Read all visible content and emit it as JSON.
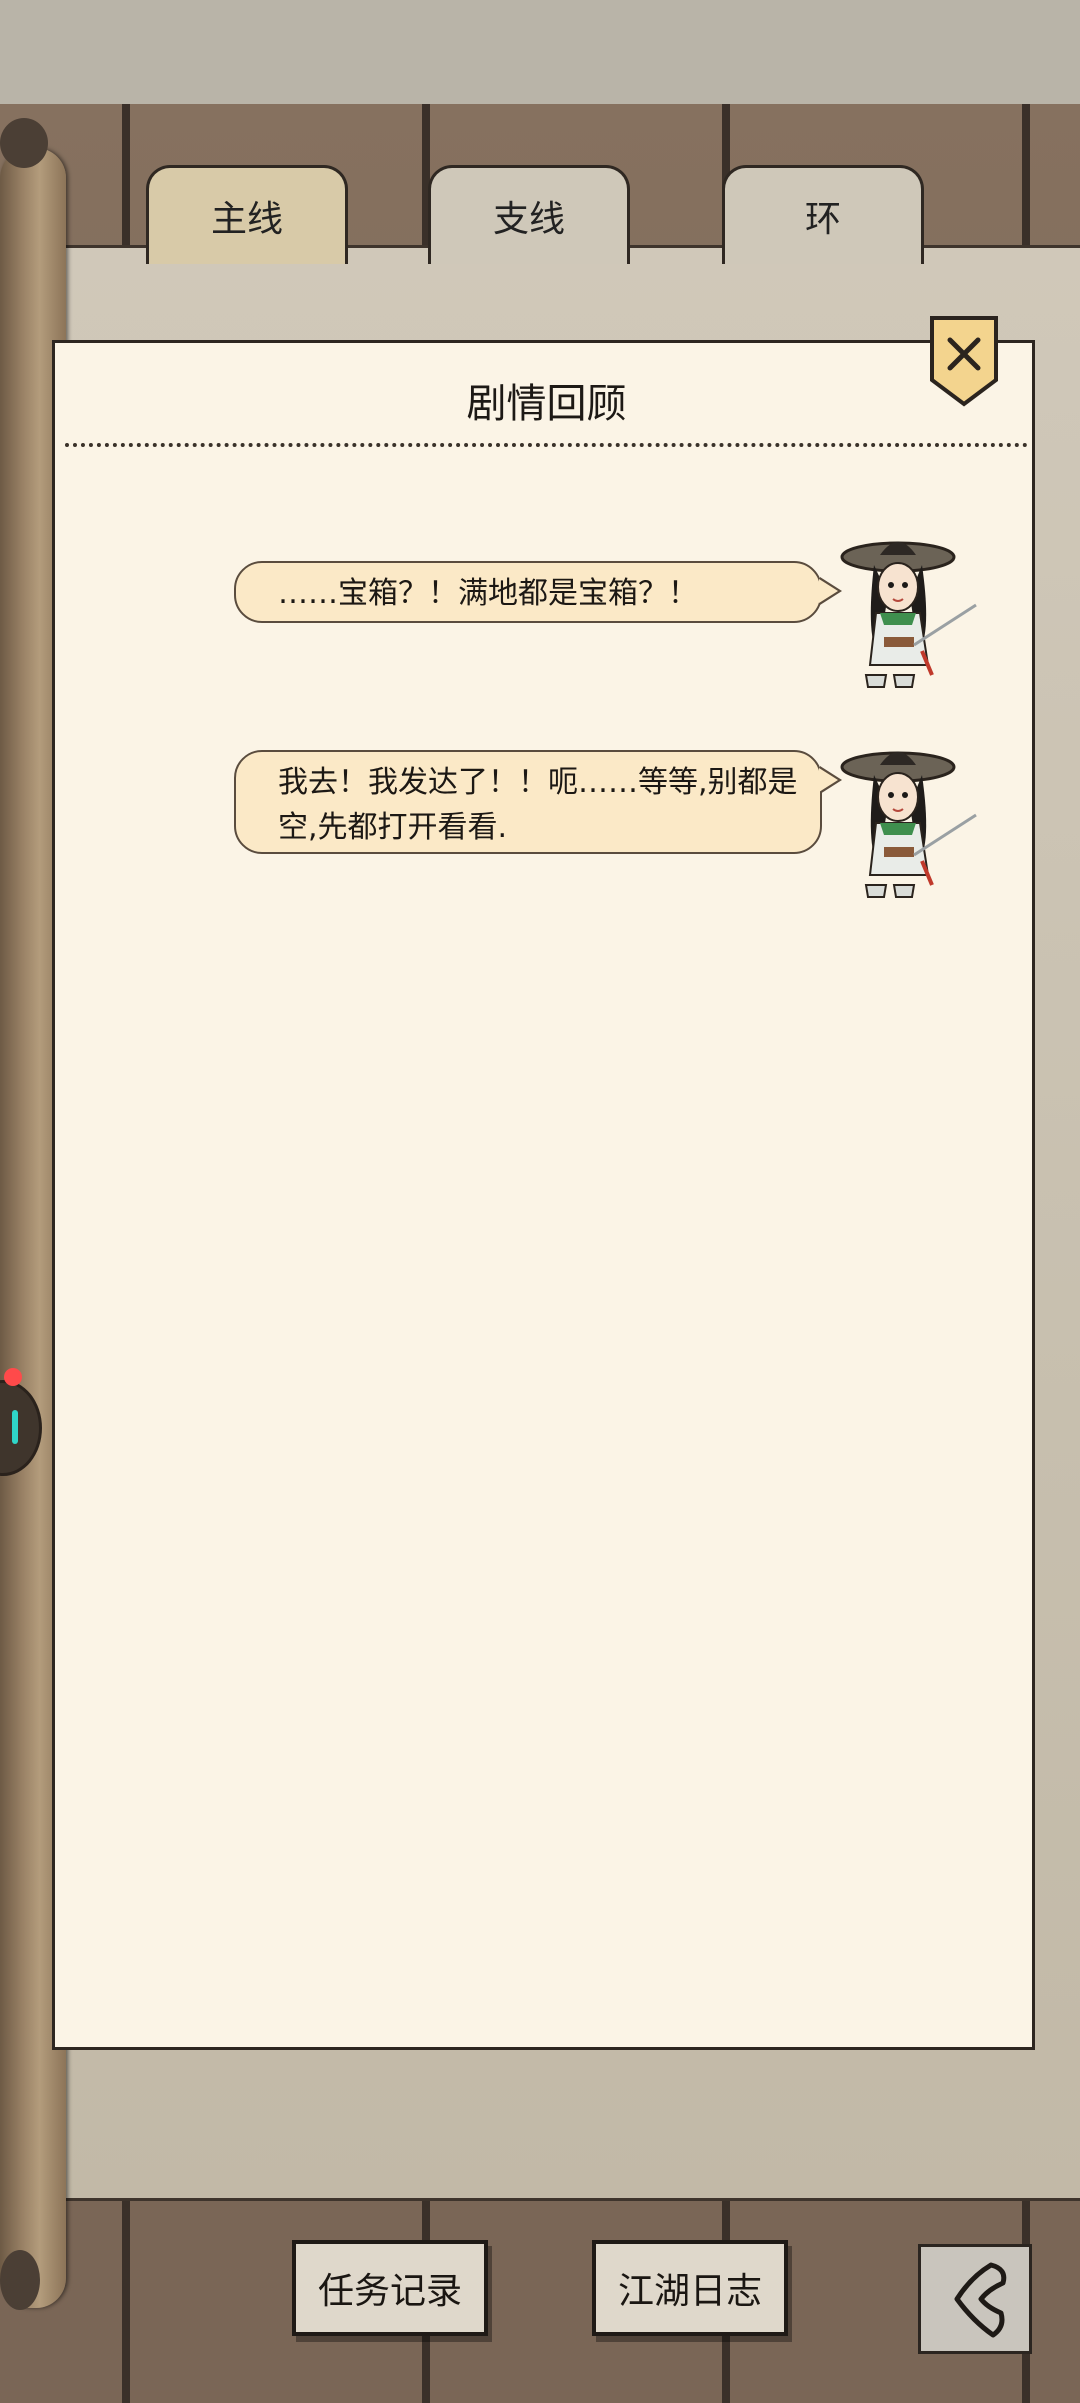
{
  "tabs": [
    {
      "label": "主线",
      "active": true
    },
    {
      "label": "支线",
      "active": false
    },
    {
      "label": "环",
      "active": false
    }
  ],
  "panel": {
    "title": "剧情回顾",
    "close_icon": "close-icon"
  },
  "dialogue": [
    {
      "text": "……宝箱？！满地都是宝箱？！",
      "speaker_avatar": "swordswoman-avatar"
    },
    {
      "text": "我去！我发达了！！呃……等等,别都是空,先都打开看看.",
      "speaker_avatar": "swordswoman-avatar"
    }
  ],
  "bottom_bar": {
    "task_log_label": "任务记录",
    "jianghu_journal_label": "江湖日志",
    "back_icon": "back-arrow-icon"
  },
  "colors": {
    "panel_bg": "#fbf4e6",
    "bubble_bg": "#fbe9c7",
    "wood_bg": "#7d6b5c",
    "notification_dot": "#ff4a4a"
  }
}
